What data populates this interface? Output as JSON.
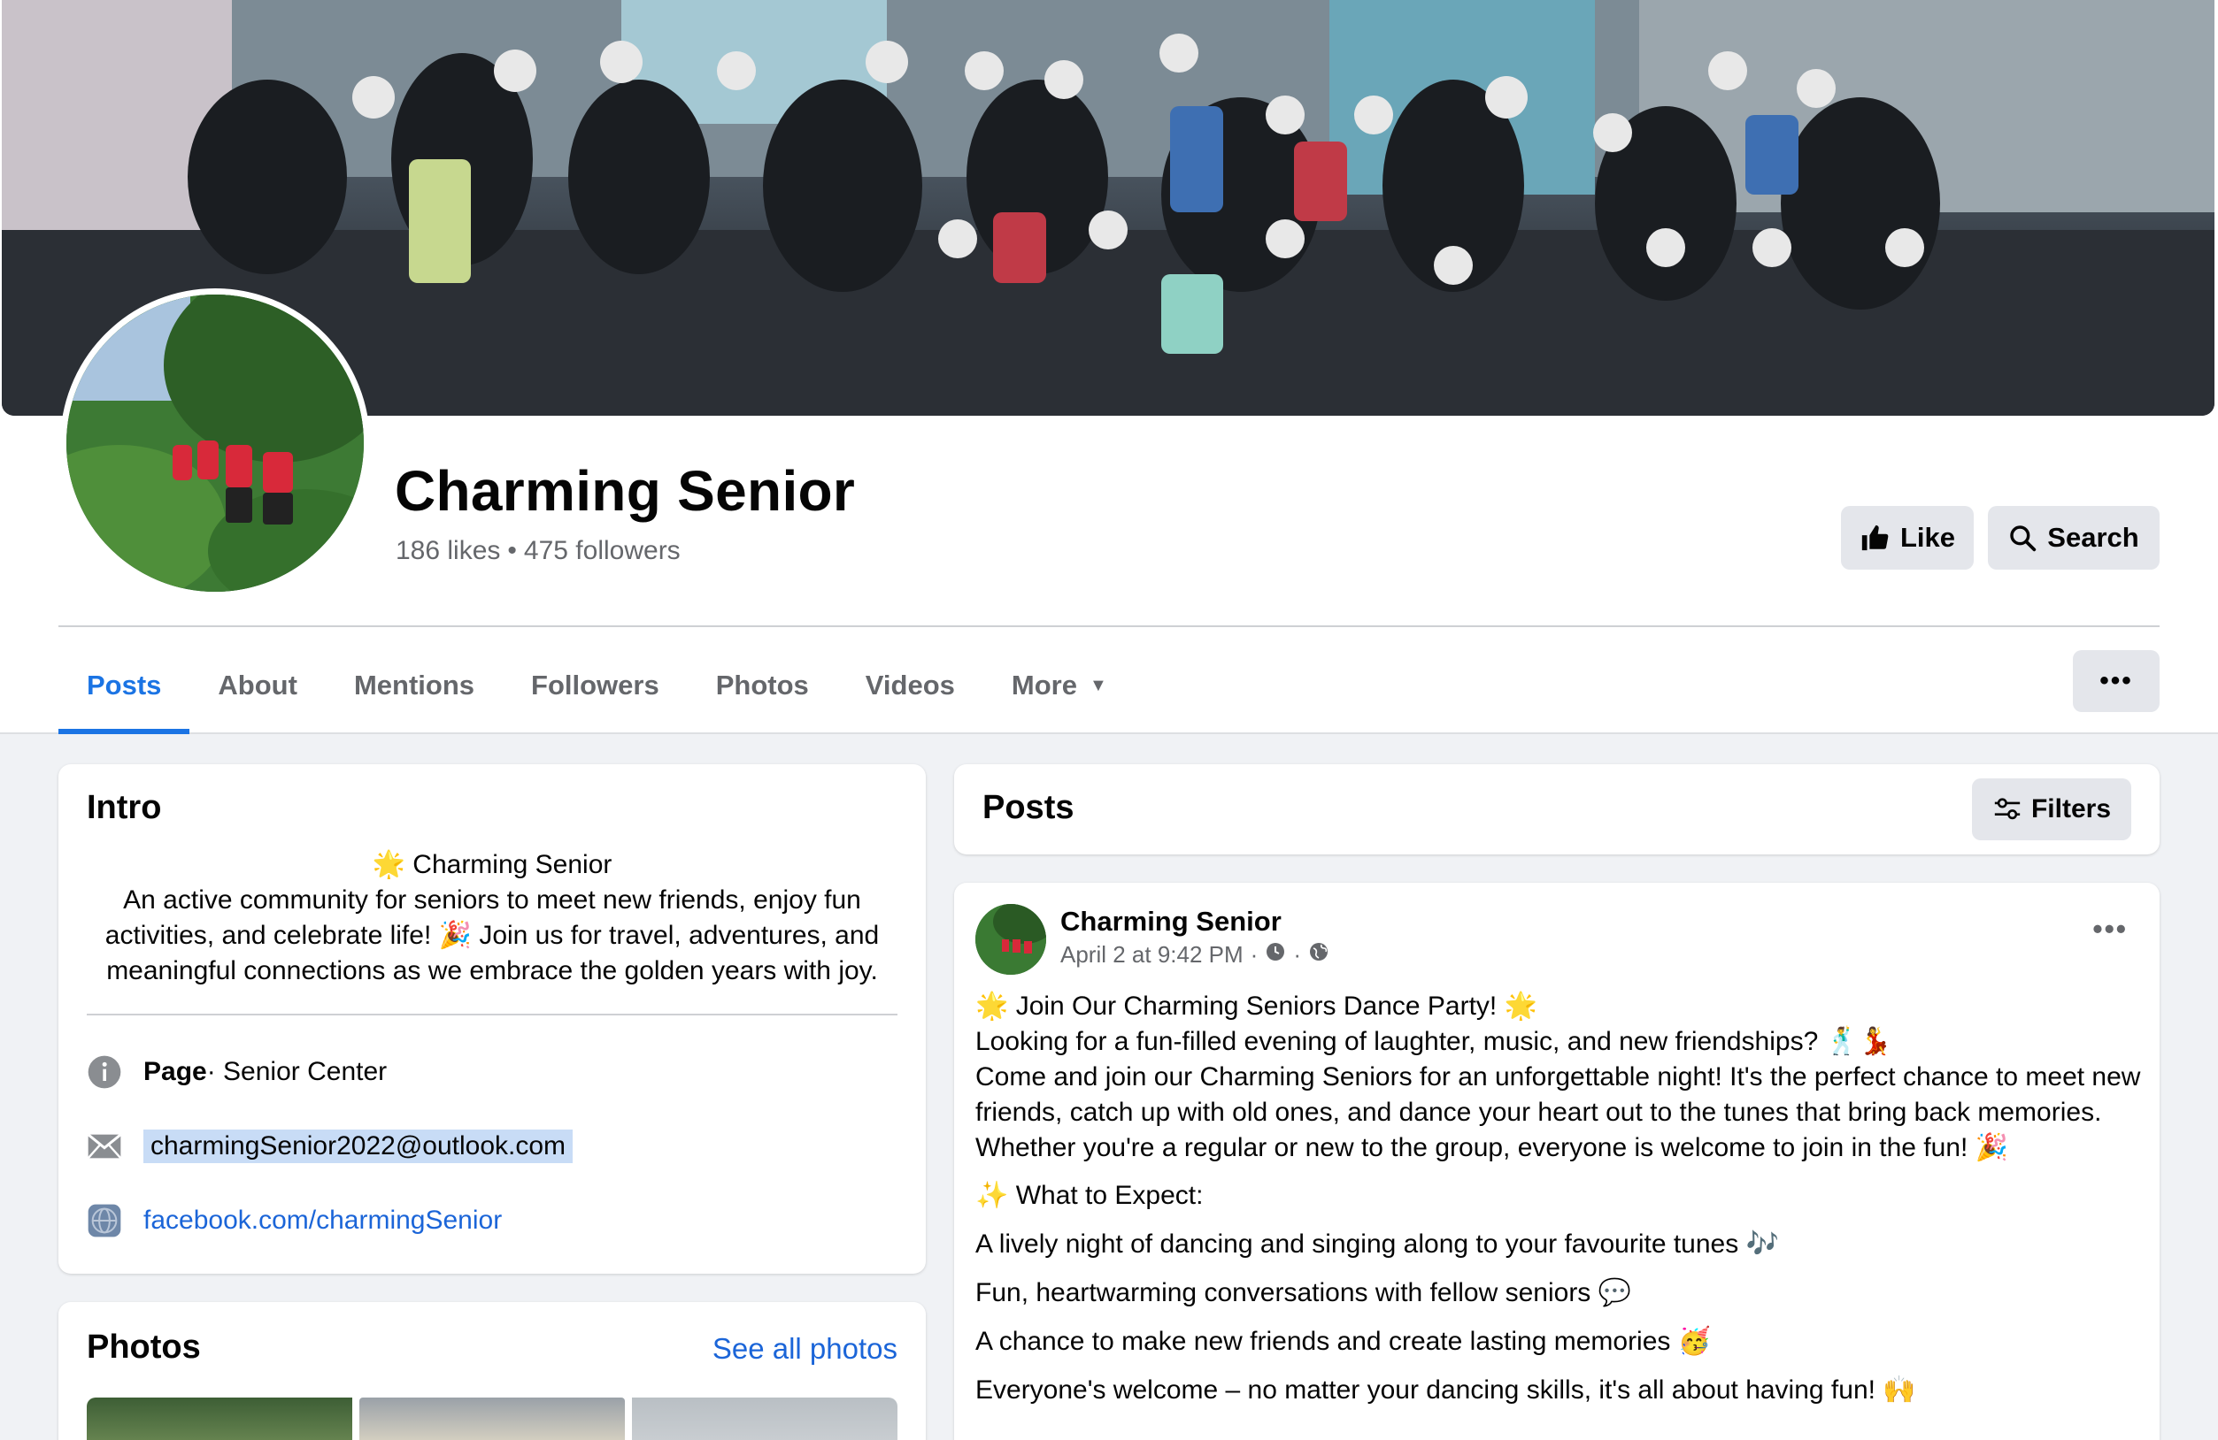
{
  "page": {
    "name": "Charming Senior",
    "likes": "186 likes",
    "separator": "•",
    "followers": "475 followers"
  },
  "header_buttons": {
    "like": "Like",
    "search": "Search"
  },
  "tabs": [
    {
      "label": "Posts",
      "active": true
    },
    {
      "label": "About"
    },
    {
      "label": "Mentions"
    },
    {
      "label": "Followers"
    },
    {
      "label": "Photos"
    },
    {
      "label": "Videos"
    },
    {
      "label": "More"
    }
  ],
  "more_options": "•••",
  "intro": {
    "title": "Intro",
    "bio_line1": "🌟 Charming Senior",
    "bio_line2": "An active community for seniors to meet new friends, enjoy fun activities, and celebrate life! 🎉 Join us for travel, adventures, and meaningful connections as we embrace the golden years with joy.",
    "category_label": "Page",
    "category_value": " · Senior Center",
    "email": "charmingSenior2022@outlook.com",
    "website": "facebook.com/charmingSenior"
  },
  "photos": {
    "title": "Photos",
    "see_all": "See all photos"
  },
  "posts_section": {
    "title": "Posts",
    "filters": "Filters"
  },
  "post": {
    "author": "Charming Senior",
    "timestamp": "April 2 at 9:42 PM",
    "meta_dot": "·",
    "options": "•••",
    "line1": "🌟 Join Our Charming Seniors Dance Party! 🌟",
    "line2": "Looking for a fun-filled evening of laughter, music, and new friendships? 🕺💃",
    "line3": "Come and join our Charming Seniors for an unforgettable night! It's the perfect chance to meet new friends, catch up with old ones, and dance your heart out to the tunes that bring back memories. Whether you're a regular or new to the group, everyone is welcome to join in the fun! 🎉",
    "expect_title": "✨ What to Expect:",
    "bullets": [
      "A lively night of dancing and singing along to your favourite tunes 🎶",
      "Fun, heartwarming conversations with fellow seniors 💬",
      "A chance to make new friends and create lasting memories 🥳",
      "Everyone's welcome – no matter your dancing skills, it's all about having fun! 🙌"
    ]
  },
  "colors": {
    "accent": "#1b74e4",
    "background": "#f0f2f5",
    "button_gray": "#e4e6eb",
    "secondary_text": "#65676b"
  },
  "icons": [
    "like-thumb-icon",
    "search-icon",
    "info-icon",
    "envelope-icon",
    "globe-icon",
    "filters-sliders-icon",
    "clock-icon",
    "public-globe-icon",
    "caret-down-icon"
  ]
}
